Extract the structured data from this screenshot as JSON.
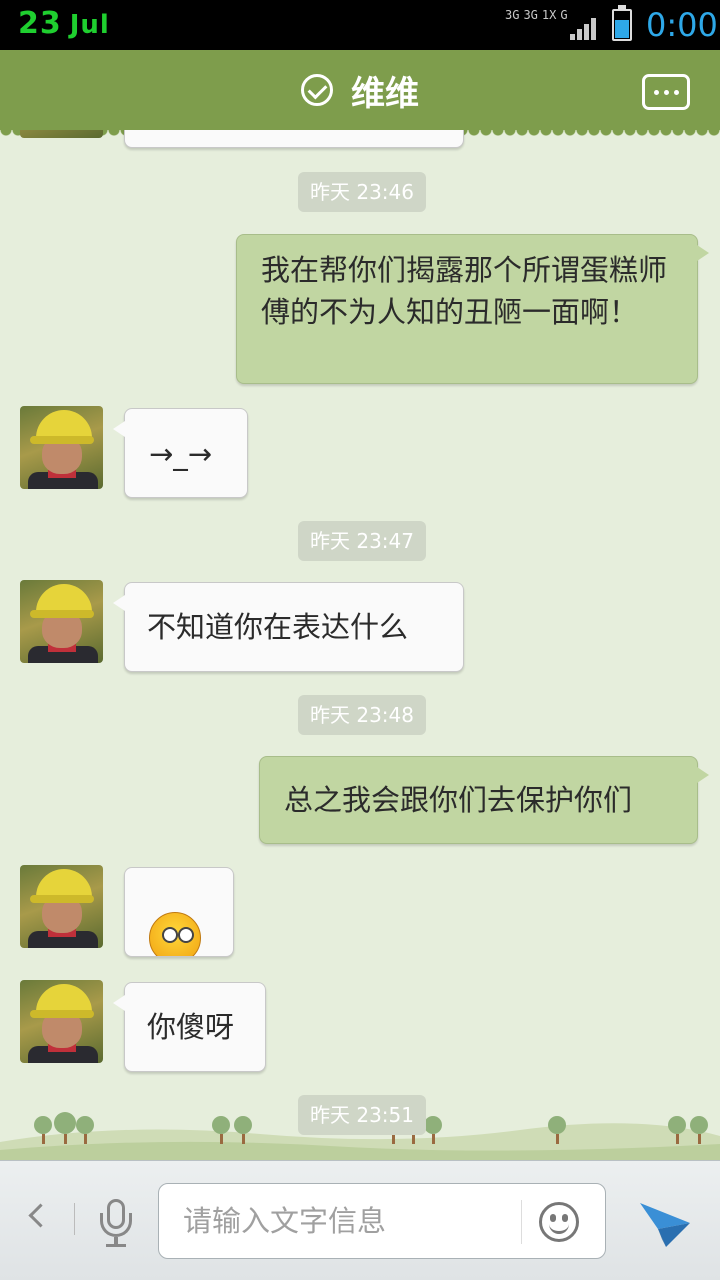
{
  "status_bar": {
    "day": "23",
    "month": "Jul",
    "network_labels": [
      "3G",
      "3G",
      "1X",
      "G"
    ],
    "time": "0:00",
    "battery_color": "#2ea8e8",
    "date_color": "#1fcf2f"
  },
  "header": {
    "title": "维维",
    "verified_icon": "check-circle-icon",
    "more_icon": "chat-bubble-more-icon",
    "bg_color": "#7e9d4c"
  },
  "chat": {
    "messages": [
      {
        "type": "timestamp",
        "text": "昨天 23:46"
      },
      {
        "type": "outgoing",
        "text": "我在帮你们揭露那个所谓蛋糕师傅的不为人知的丑陋一面啊！"
      },
      {
        "type": "incoming",
        "text": "→_→"
      },
      {
        "type": "timestamp",
        "text": "昨天 23:47"
      },
      {
        "type": "incoming",
        "text": "不知道你在表达什么"
      },
      {
        "type": "timestamp",
        "text": "昨天 23:48"
      },
      {
        "type": "outgoing",
        "text": "总之我会跟你们去保护你们"
      },
      {
        "type": "incoming",
        "emoji": "peeking-face-emoji"
      },
      {
        "type": "incoming",
        "text": "你傻呀"
      },
      {
        "type": "timestamp",
        "text": "昨天 23:51"
      }
    ],
    "bubble_out_color": "#c1d6a2",
    "bubble_in_color": "#fafafa"
  },
  "input_bar": {
    "placeholder": "请输入文字信息",
    "back_icon": "chevron-left-icon",
    "voice_icon": "microphone-icon",
    "emoji_icon": "smiley-icon",
    "send_icon": "paper-plane-send-icon"
  }
}
